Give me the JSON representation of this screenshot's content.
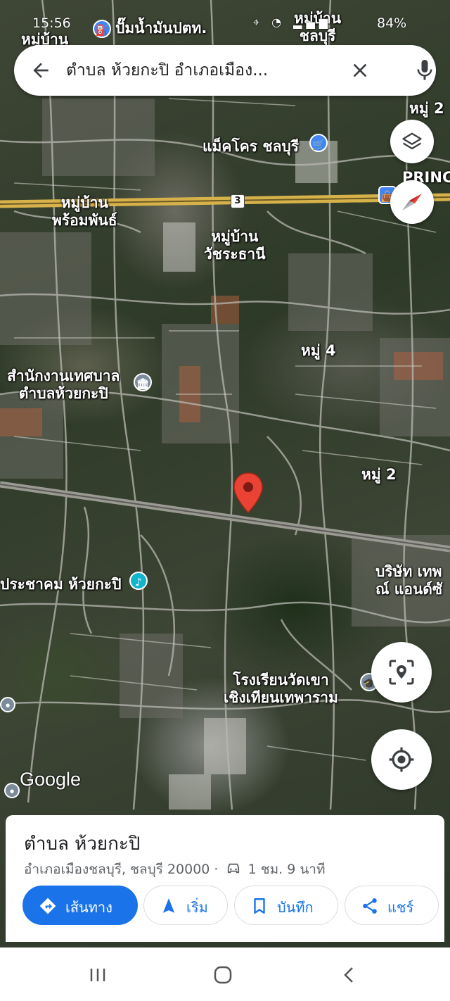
{
  "status_bar": {
    "time": "15:56",
    "battery": "84%"
  },
  "search": {
    "query": "ตำบล ห้วยกะปิ อำเภอเมือง..."
  },
  "map_labels": {
    "top_gas": "ปั๊มน้ำมันปตท.",
    "top_village_1": "หมู่บ้าน\nชลบุรี",
    "top_left_village": "หมู่บ้าน",
    "moo2_top": "หมู่ 2",
    "makro": "แม็คโคร ชลบุรี",
    "princ": "PRINC",
    "village_phromphan": "หมู่บ้าน\nพร้อมพันธ์",
    "village_watcharathani": "หมู่บ้าน\nวัชระธานี",
    "moo4": "หมู่ 4",
    "municipal_office": "สำนักงานเทศบาล\nตำบลห้วยกะปิ",
    "moo2_mid": "หมู่ 2",
    "company": "บริษัท เทพ\nณ์ แอนด์ซั",
    "community": "ประชาคม ห้วยกะปิ",
    "school": "โรงเรียนวัดเขา\nเชิงเทียนเทพาราม",
    "route_number": "3",
    "google": "Google"
  },
  "place": {
    "title": "ตำบล ห้วยกะปิ",
    "subtitle": "อำเภอเมืองชลบุรี, ชลบุรี 20000 · ",
    "drive_time": "1 ชม. 9 นาที"
  },
  "actions": {
    "directions": "เส้นทาง",
    "start": "เริ่ม",
    "save": "บันทึก",
    "share": "แชร์"
  },
  "colors": {
    "accent": "#1a73e8",
    "pin": "#d93025"
  }
}
